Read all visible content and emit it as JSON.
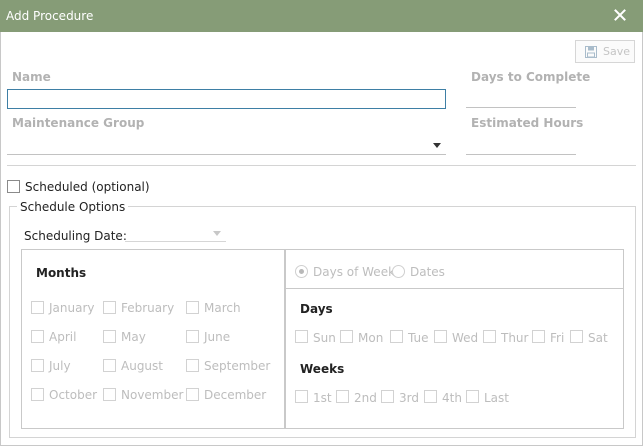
{
  "dialog": {
    "title": "Add Procedure"
  },
  "toolbar": {
    "save_label": "Save"
  },
  "form": {
    "name_label": "Name",
    "name_value": "",
    "days_label": "Days to Complete",
    "days_value": "",
    "group_label": "Maintenance Group",
    "group_value": "",
    "hours_label": "Estimated Hours",
    "hours_value": "",
    "scheduled_label": "Scheduled (optional)",
    "scheduled_checked": false
  },
  "schedule": {
    "group_title": "Schedule Options",
    "date_label": "Scheduling Date:",
    "date_value": "",
    "months_title": "Months",
    "months": [
      "January",
      "February",
      "March",
      "April",
      "May",
      "June",
      "July",
      "August",
      "September",
      "October",
      "November",
      "December"
    ],
    "mode_options": [
      "Days of Week",
      "Dates"
    ],
    "mode_selected": "Days of Week",
    "days_title": "Days",
    "days": [
      "Sun",
      "Mon",
      "Tue",
      "Wed",
      "Thur",
      "Fri",
      "Sat"
    ],
    "weeks_title": "Weeks",
    "weeks": [
      "1st",
      "2nd",
      "3rd",
      "4th",
      "Last"
    ]
  },
  "colors": {
    "titlebar": "#869c77",
    "input_focus_border": "#3e7fa5",
    "disabled_text": "#bdbdbd"
  },
  "icons": {
    "close": "close-icon",
    "save": "save-icon"
  }
}
